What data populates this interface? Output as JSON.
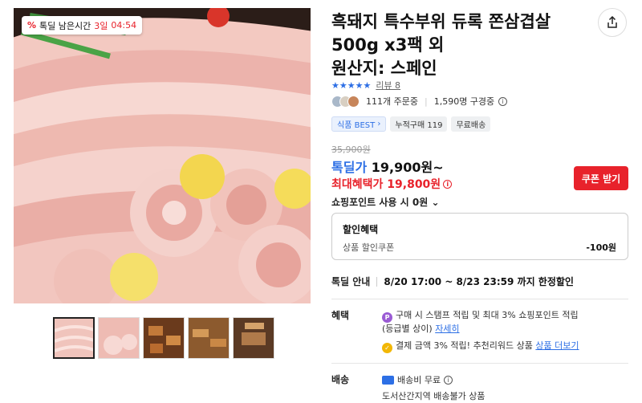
{
  "timer": {
    "label": "톡딜 남은시간",
    "days": "3일",
    "time": "04:54"
  },
  "product": {
    "title_line1": "흑돼지 특수부위 듀록 쫀삼겹살",
    "title_line2": "500g x3팩 외",
    "title_line3": "원산지: 스페인"
  },
  "rating": {
    "stars": "★★★★★",
    "review_label": "리뷰 8"
  },
  "orders": {
    "ordering": "111개 주문중",
    "subscribing": "1,590명 구경중"
  },
  "tags": [
    "식품 BEST",
    "누적구매 119",
    "무료배송"
  ],
  "price": {
    "original": "35,900원",
    "deal_label": "톡딜가",
    "deal_value": "19,900원~",
    "max_benefit": "최대혜택가 19,800원",
    "coupon_button": "쿠폰 받기",
    "points": "쇼핑포인트 사용 시 0원"
  },
  "discount": {
    "title": "할인혜택",
    "name": "상품 할인쿠폰",
    "value": "-100원"
  },
  "deal_guide": {
    "label": "톡딜 안내",
    "value": "8/20 17:00 ~ 8/23 23:59 까지 한정할인"
  },
  "benefit": {
    "label": "혜택",
    "line1": "구매 시 스탬프 적립 및 최대 3% 쇼핑포인트 적립",
    "line1b": "(등급별 상이)",
    "line1_link": "자세히",
    "line2": "결제 금액 3% 적립! 추천리워드 상품",
    "line2_link": "상품 더보기"
  },
  "shipping": {
    "label": "배송",
    "line1": "배송비 무료",
    "line2": "도서산간지역 배송불가 상품"
  },
  "colors": {
    "accent_red": "#e8222b",
    "accent_blue": "#2d6fe5"
  }
}
